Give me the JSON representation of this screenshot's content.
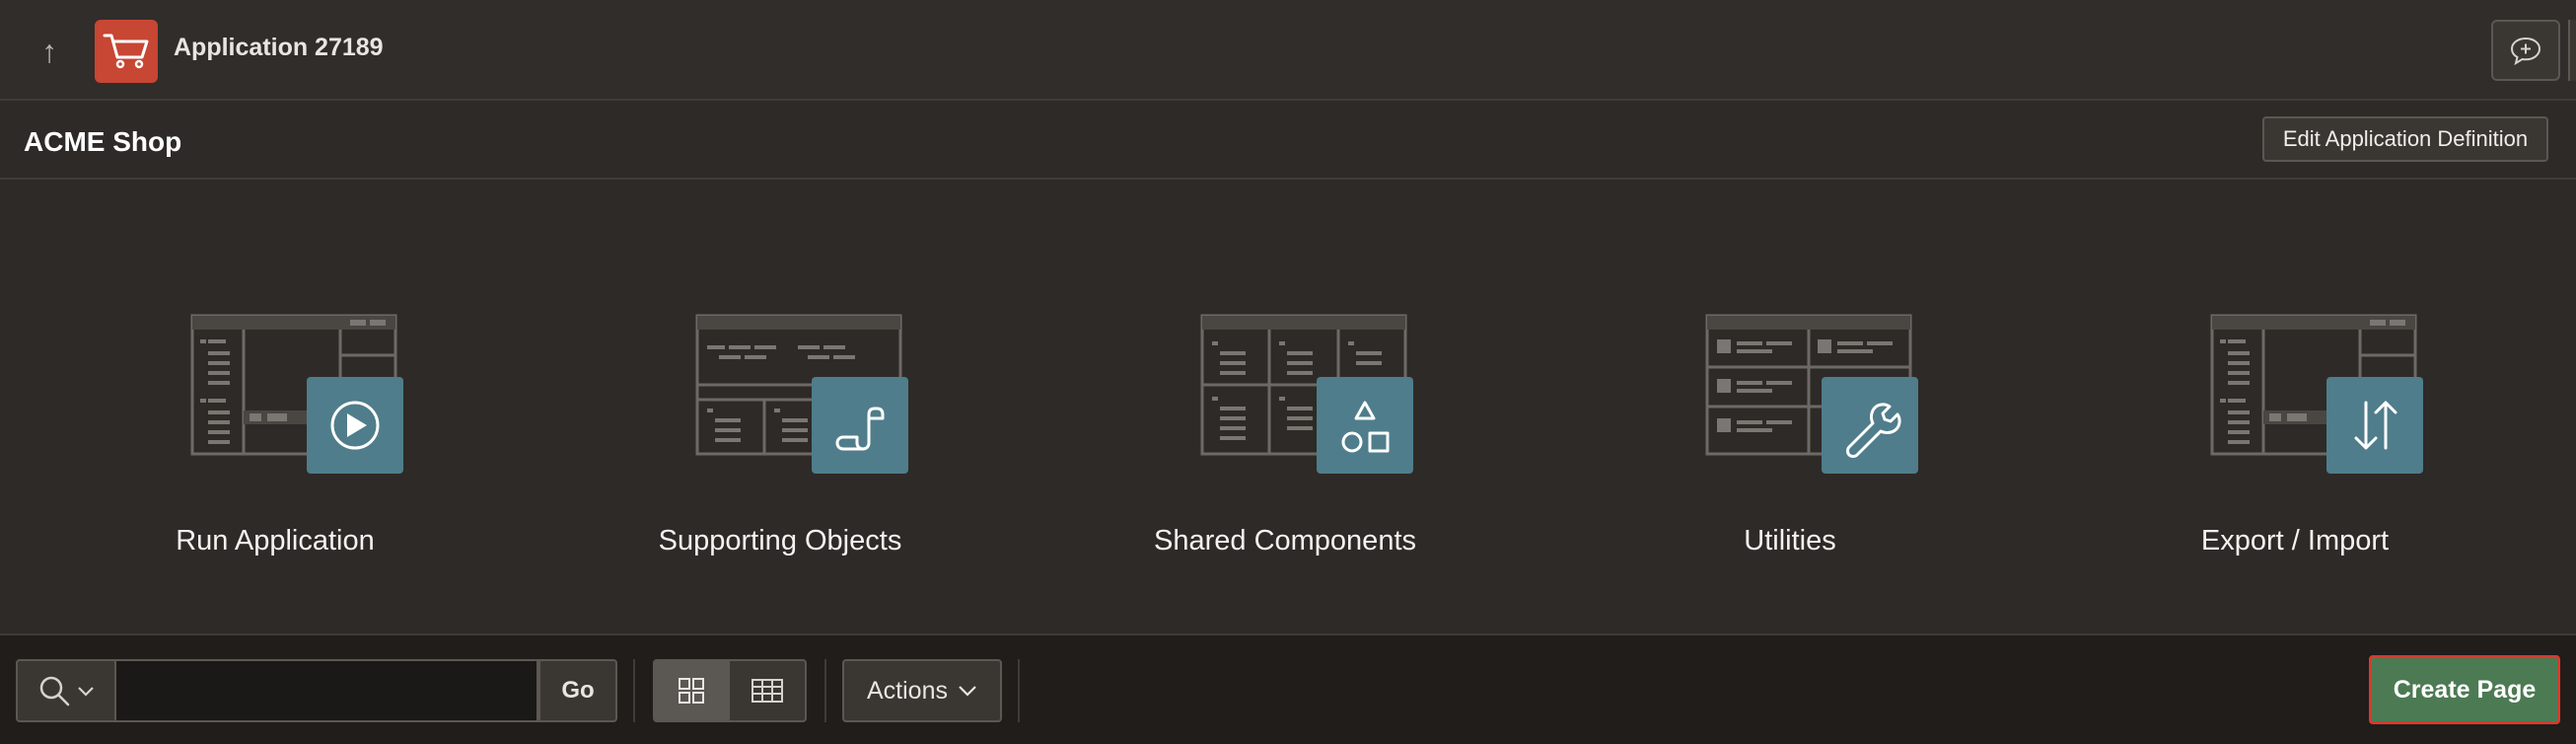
{
  "header": {
    "app_title": "Application 27189",
    "up_icon": "arrow-up-icon",
    "app_icon": "shopping-cart-icon",
    "app_icon_color": "#c74634",
    "feedback_icon": "feedback-chat-icon"
  },
  "page": {
    "title": "ACME Shop",
    "edit_definition_label": "Edit Application Definition"
  },
  "tiles": [
    {
      "label": "Run Application",
      "icon": "play-icon"
    },
    {
      "label": "Supporting Objects",
      "icon": "scroll-icon"
    },
    {
      "label": "Shared Components",
      "icon": "shapes-icon"
    },
    {
      "label": "Utilities",
      "icon": "wrench-icon"
    },
    {
      "label": "Export / Import",
      "icon": "up-down-arrows-icon"
    }
  ],
  "toolbar": {
    "search_placeholder": "",
    "search_value": "",
    "go_label": "Go",
    "actions_label": "Actions",
    "create_page_label": "Create Page",
    "create_page_color": "#4c7a53",
    "highlight_color": "#d93a2b",
    "accent_color": "#4f7d8b"
  }
}
